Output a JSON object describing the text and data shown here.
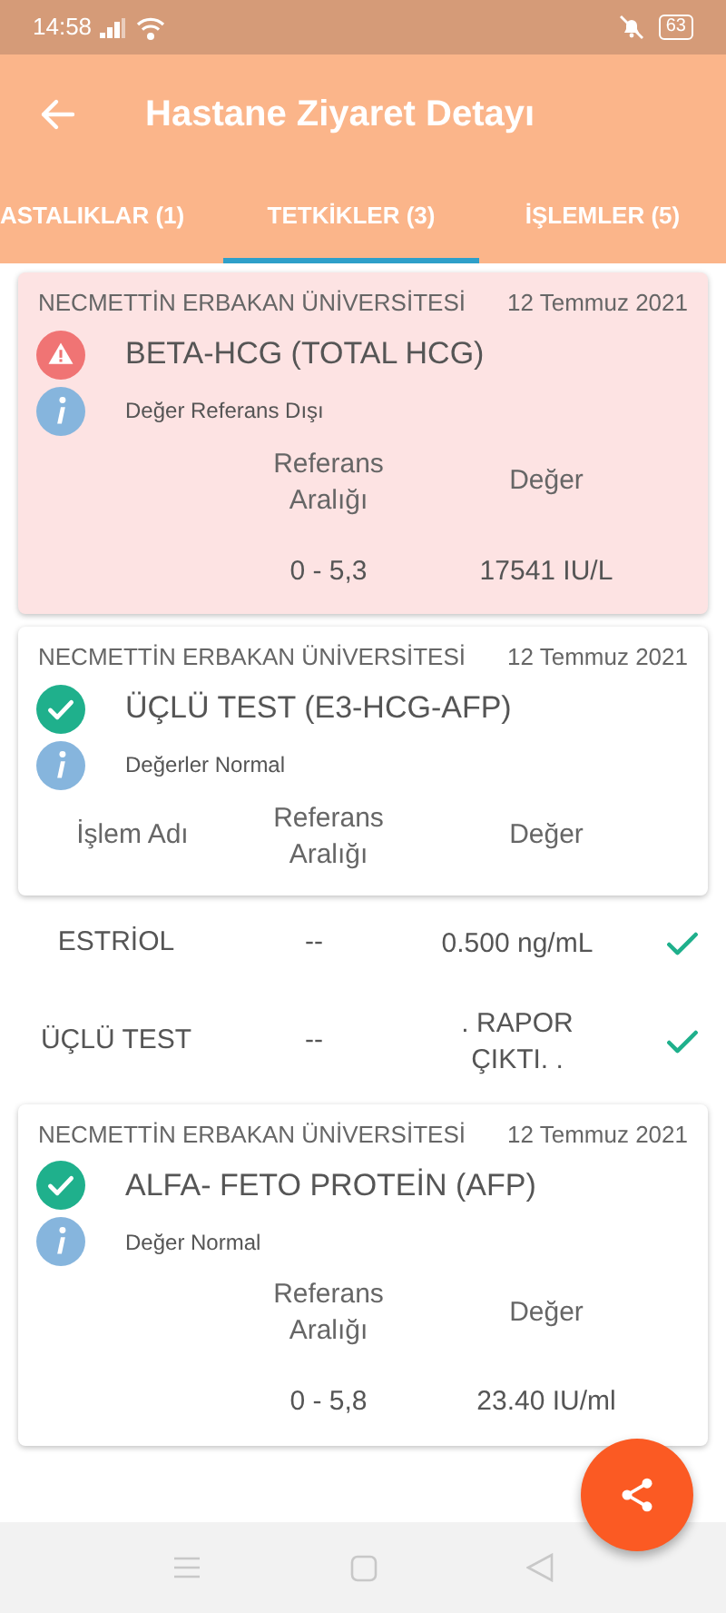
{
  "status_bar": {
    "time": "14:58",
    "battery": "63"
  },
  "header": {
    "title": "Hastane Ziyaret Detayı"
  },
  "tabs": [
    {
      "label": "ASTALIKLAR (1)",
      "selected": false
    },
    {
      "label": "TETKİKLER (3)",
      "selected": true
    },
    {
      "label": "İŞLEMLER (5)",
      "selected": false
    }
  ],
  "results": [
    {
      "kind": "alert",
      "institution": "NECMETTİN ERBAKAN ÜNİVERSİTESİ",
      "date": "12 Temmuz 2021",
      "test": "BETA-HCG (TOTAL HCG)",
      "note": "Değer Referans Dışı",
      "columns": {
        "reference": "Referans Aralığı",
        "value": "Değer"
      },
      "rows": [
        {
          "reference": "0 - 5,3",
          "value": "17541 IU/L"
        }
      ]
    },
    {
      "kind": "normal",
      "institution": "NECMETTİN ERBAKAN ÜNİVERSİTESİ",
      "date": "12 Temmuz 2021",
      "test": "ÜÇLÜ TEST (E3-HCG-AFP)",
      "note": "Değerler Normal",
      "columns": {
        "name": "İşlem Adı",
        "reference": "Referans Aralığı",
        "value": "Değer"
      },
      "sub_rows": [
        {
          "name": "ESTRİOL",
          "reference": "--",
          "value": "0.500  ng/mL",
          "checked": true
        },
        {
          "name": "ÜÇLÜ TEST",
          "reference": "--",
          "value": ". RAPOR ÇIKTI. .",
          "checked": true
        }
      ]
    },
    {
      "kind": "normal",
      "institution": "NECMETTİN ERBAKAN ÜNİVERSİTESİ",
      "date": "12 Temmuz 2021",
      "test": "ALFA- FETO PROTEİN (AFP)",
      "note": "Değer Normal",
      "columns": {
        "reference": "Referans Aralığı",
        "value": "Değer"
      },
      "rows": [
        {
          "reference": "0 - 5,8",
          "value": "23.40  IU/ml"
        }
      ]
    }
  ]
}
